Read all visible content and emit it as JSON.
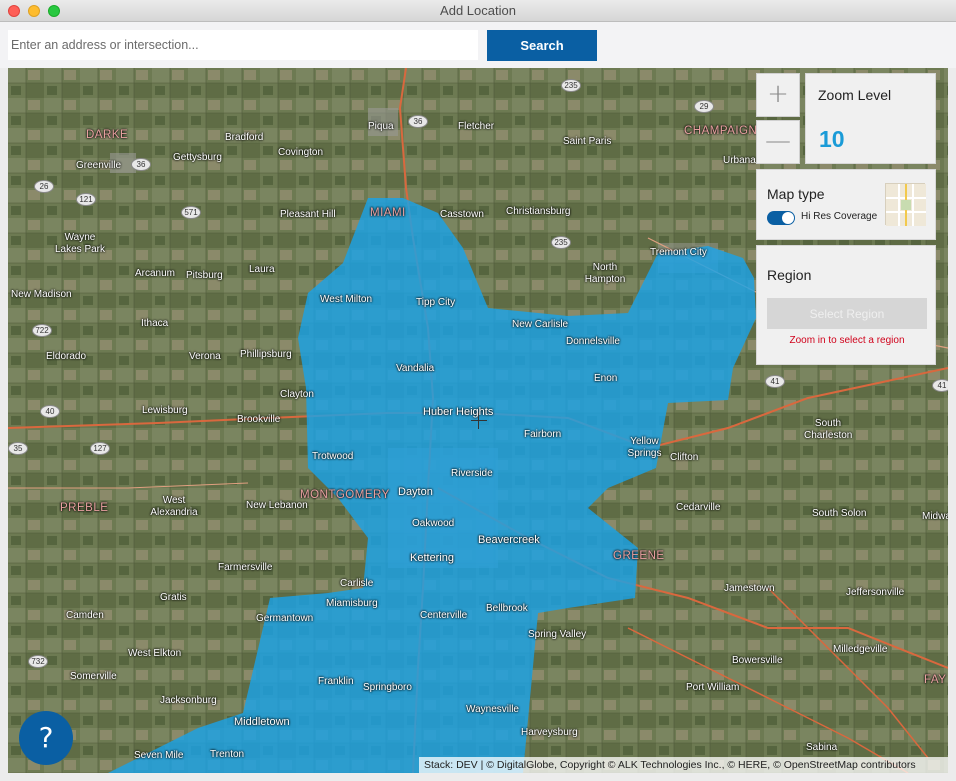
{
  "window": {
    "title": "Add Location"
  },
  "search": {
    "placeholder": "Enter an address or intersection...",
    "button_label": "Search"
  },
  "zoom": {
    "in_symbol": "+",
    "out_symbol": "—",
    "title": "Zoom Level",
    "value": "10"
  },
  "map_type": {
    "title": "Map type",
    "toggle_label": "Hi Res Coverage",
    "toggle_on": true
  },
  "region": {
    "title": "Region",
    "button_label": "Select Region",
    "message": "Zoom in to select a region"
  },
  "help": {
    "label": "?"
  },
  "attribution": "Stack: DEV | © DigitalGlobe, Copyright © ALK Technologies Inc., © HERE, © OpenStreetMap contributors",
  "colors": {
    "accent": "#0a5fa3",
    "coverage": "#1ba2e6",
    "zoom_value": "#1a9bd7",
    "error": "#d0021b"
  },
  "map": {
    "counties": [
      "DARKE",
      "CHAMPAIGN",
      "MIAMI",
      "MONTGOMERY",
      "PREBLE",
      "GREENE",
      "FAY"
    ],
    "places": [
      "Piqua",
      "Fletcher",
      "Bradford",
      "Covington",
      "Greenville",
      "Gettysburg",
      "Saint Paris",
      "Urbana",
      "Pleasant Hill",
      "Casstown",
      "Christiansburg",
      "Wayne Lakes Park",
      "Arcanum",
      "Pitsburg",
      "Laura",
      "North Hampton",
      "New Madison",
      "Ithaca",
      "Eldorado",
      "Verona",
      "Phillipsburg",
      "Clayton",
      "Lewisburg",
      "Brookville",
      "Huber Heights",
      "Dayton",
      "Kettering",
      "Beavercreek",
      "Trotwood",
      "Riverside",
      "Fairborn",
      "Yellow Springs",
      "Clifton",
      "South Charleston",
      "West Alexandria",
      "New Lebanon",
      "Cedarville",
      "South Solon",
      "Farmersville",
      "Jamestown",
      "Jeffersonville",
      "Gratis",
      "Camden",
      "Germantown",
      "Miamisburg",
      "Bellbrook",
      "Spring Valley",
      "West Elkton",
      "Somerville",
      "Jacksonburg",
      "Bowersville",
      "Port William",
      "Milledgeville",
      "Middletown",
      "Franklin",
      "Springboro",
      "Waynesville",
      "Harveysburg",
      "Sabina",
      "Tipp City",
      "Vandalia",
      "New Carlisle",
      "Donnelsville",
      "Enon",
      "West Milton",
      "Tremont City",
      "Oakwood",
      "Centerville",
      "Carlisle",
      "Trenton",
      "Seven Mile",
      "Midway"
    ],
    "route_shields": [
      "235",
      "29",
      "36",
      "36",
      "26",
      "121",
      "571",
      "235",
      "722",
      "40",
      "127",
      "35",
      "41",
      "732",
      "41"
    ]
  }
}
